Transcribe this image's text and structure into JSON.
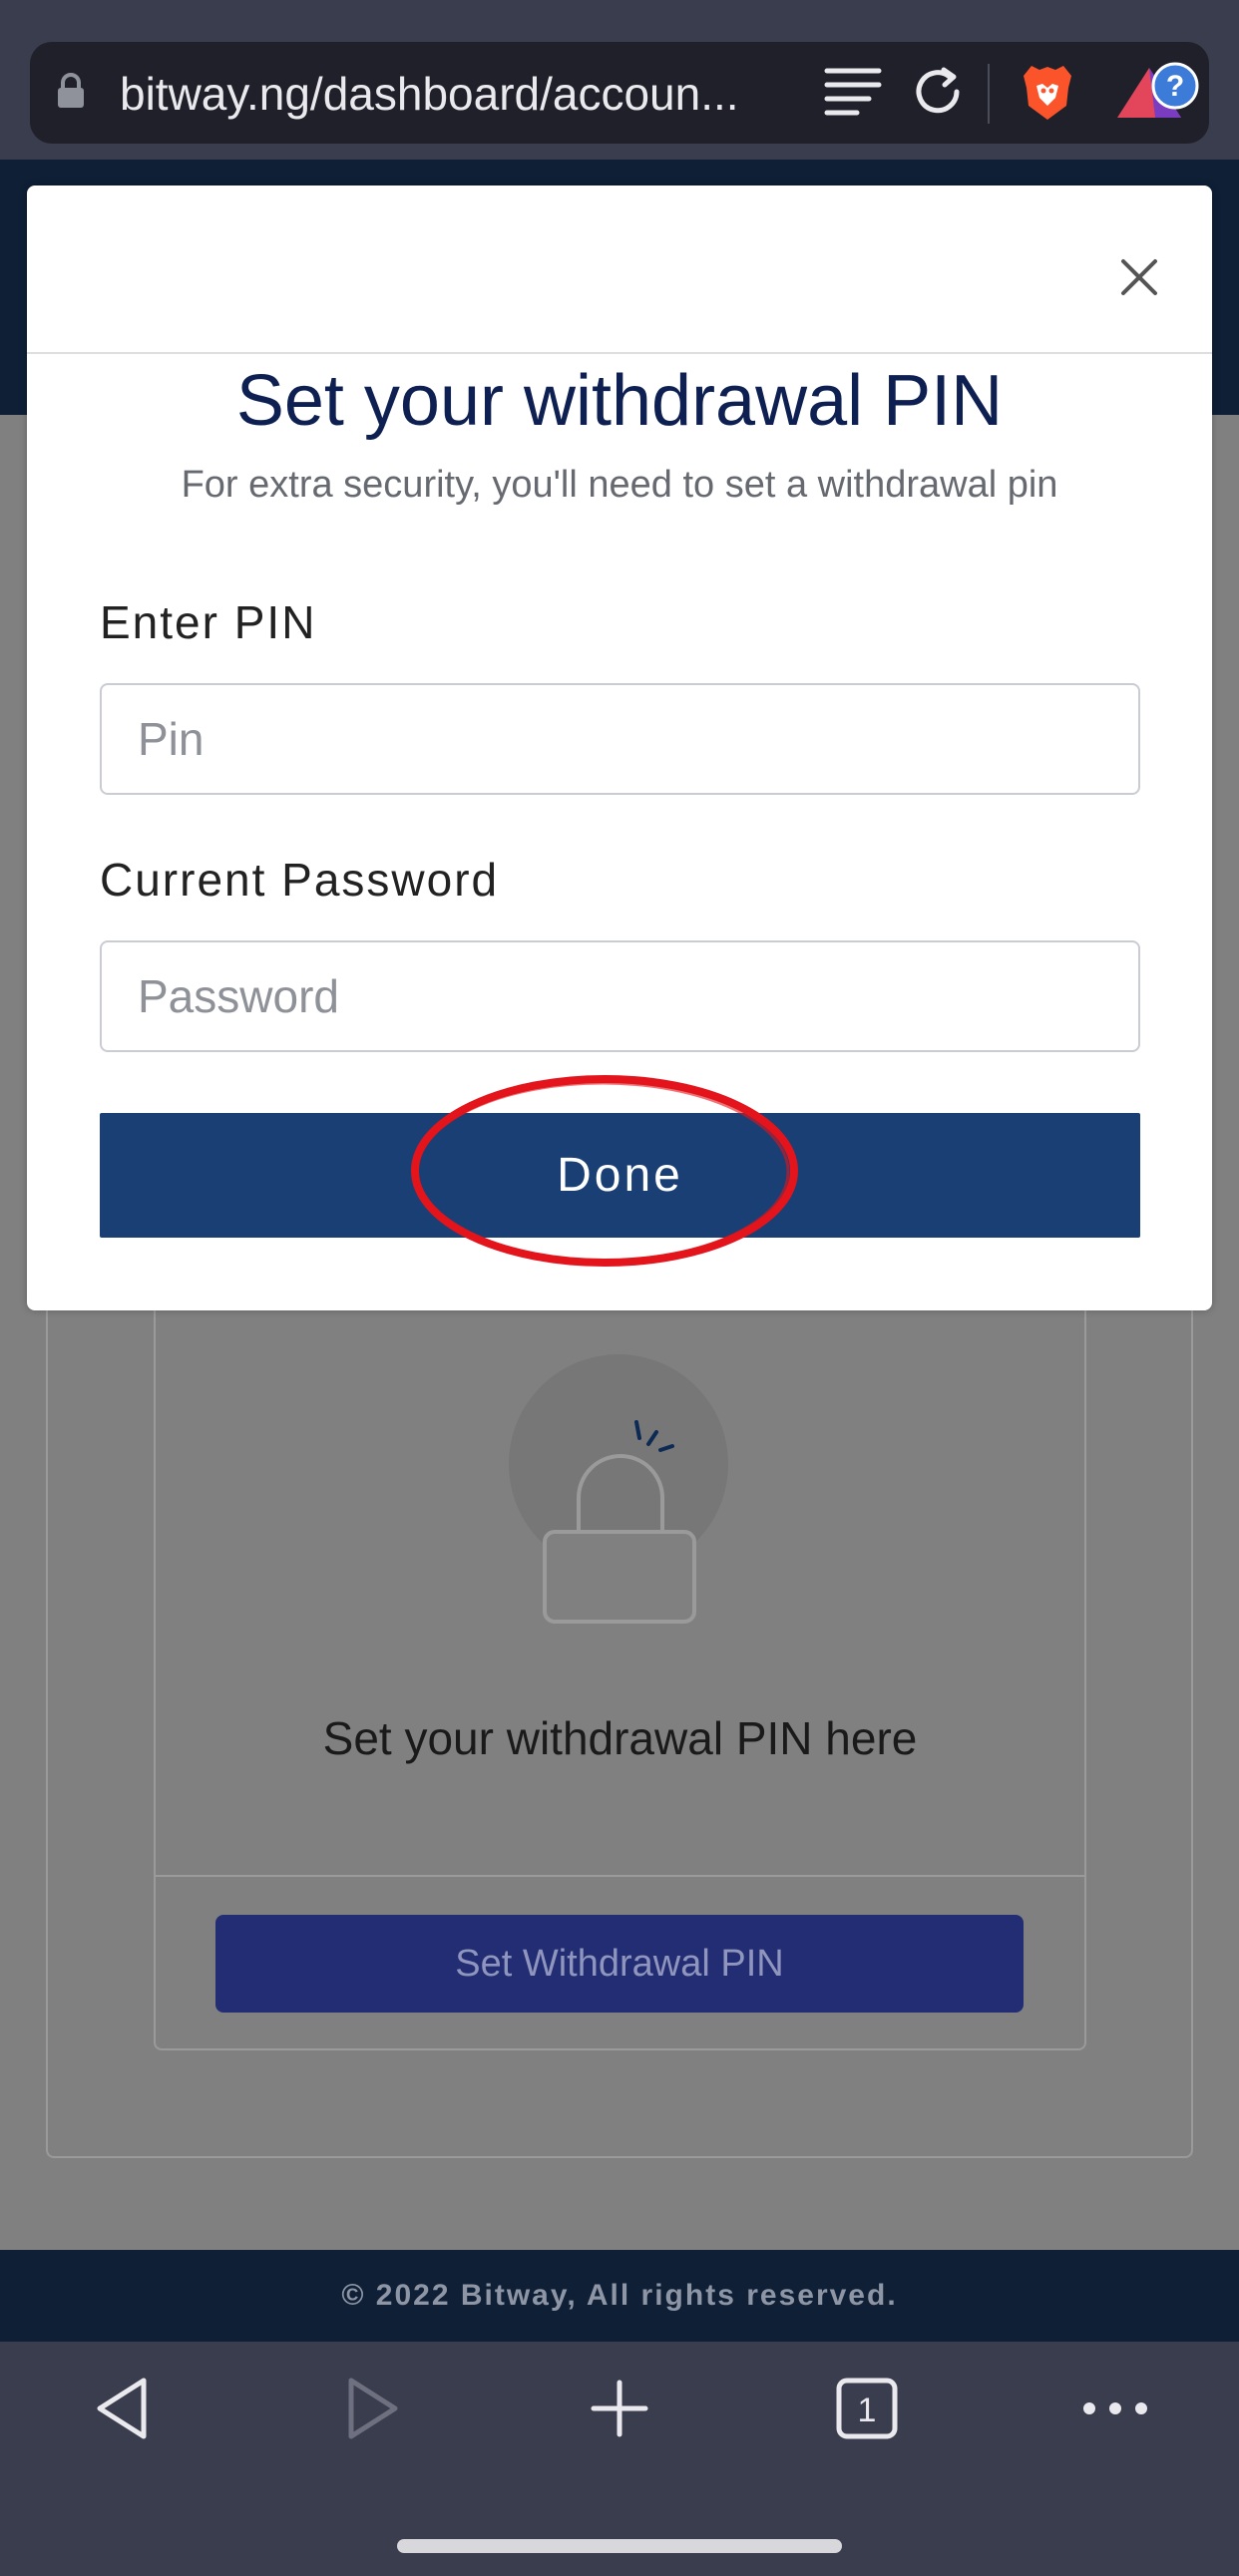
{
  "browser": {
    "url": "bitway.ng/dashboard/accoun...",
    "icons": [
      "lock-icon",
      "reader-mode-icon",
      "reload-icon",
      "brave-shield-icon",
      "rewards-icon"
    ],
    "rewards_badge": "?",
    "tab_count": "1",
    "bottom_nav_icons": [
      "back-icon",
      "forward-icon",
      "new-tab-icon",
      "tabs-icon",
      "more-icon"
    ]
  },
  "page": {
    "set_pin_text": "Set your withdrawal PIN here",
    "set_pin_button": "Set Withdrawal PIN",
    "footer": "© 2022 Bitway, All rights reserved."
  },
  "modal": {
    "title": "Set your withdrawal PIN",
    "subtitle": "For extra security, you'll need to set a withdrawal pin",
    "pin_label": "Enter PIN",
    "pin_placeholder": "Pin",
    "password_label": "Current Password",
    "password_placeholder": "Password",
    "done_button": "Done"
  },
  "colors": {
    "header": "#0e1f36",
    "done_button": "#1a3f74",
    "title": "#0e1f52",
    "annotation": "#e3141b"
  }
}
